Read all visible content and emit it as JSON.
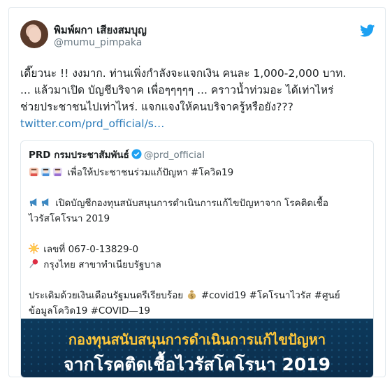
{
  "tweet": {
    "display_name": "พิมพ์ผกา เสียงสมบุญ",
    "handle": "@mumu_pimpaka",
    "text_lines": [
      "เดี๊ยวนะ !!  งงมาก. ท่านเพิ่งกำลังจะแจกเงิน คนละ 1,000-2,000 บาท.",
      "... แล้วมาเปิด บัญชีบริจาค เพื่อๆๆๆๆๆ ... คราวน้ำท่วมอะ ได้เท่าไหร่",
      "ช่วยประชาชนไปเท่าไหร่. แจกแจงให้คนบริจาครู้หรือยัง???"
    ],
    "link": "twitter.com/prd_official/s…"
  },
  "quote": {
    "name": "PRD กรมประชาสัมพันธ์",
    "handle": "@prd_official",
    "line1": "เพื่อให้ประชาชนร่วมแก้ปัญหา #โควิด19",
    "line2a": "เปิดบัญชีกองทุนสนับสนุนการดำเนินการแก้ไขปัญหาจาก โรคติดเชื้อ",
    "line2b": "ไวรัสโคโรนา 2019",
    "line3": "เลขที่ 067-0-13829-0",
    "line4": "กรุงไทย สาขาทำเนียบรัฐบาล",
    "line5a": "ประเดิมด้วยเงินเดือนรัฐมนตรีเรียบร้อย",
    "line5b": "#covid19 #โคโรนาไวรัส #ศูนย์",
    "line5c": "ข้อมูลโควิด19 #COVID—19"
  },
  "banner": {
    "line1": "กองทุนสนับสนุนการดำเนินการแก้ไขปัญหา",
    "line2": "จากโรคติดเชื้อไวรัสโคโรนา 2019"
  },
  "icons": {
    "logo": "twitter-bird-icon",
    "verified": "verified-badge-icon",
    "emoji_people": "people-emoji-icon",
    "emoji_megaphone": "megaphone-emoji-icon",
    "emoji_star": "star-emoji-icon",
    "emoji_pin": "pushpin-emoji-icon",
    "emoji_money": "money-bag-emoji-icon"
  },
  "colors": {
    "twitter_blue": "#1da1f2",
    "link": "#2b7bb9",
    "banner_yellow": "#ffc73a"
  }
}
